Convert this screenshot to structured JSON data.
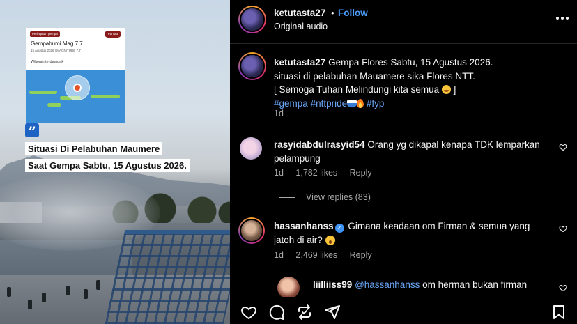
{
  "media": {
    "news_card": {
      "badge": "Peringatan gempa",
      "pill": "Pantau",
      "title": "Gempabumi Mag 7.7",
      "subtitle": "15 Agustus 2026 | MAGNITUDE 7.7",
      "area_label": "Wilayah terdampak"
    },
    "quote_icon": "quote-icon",
    "caption_line1": "Situasi Di Pelabuhan Maumere",
    "caption_line2": "Saat Gempa Sabtu, 15 Agustus 2026."
  },
  "post": {
    "username": "ketutasta27",
    "dot": "•",
    "follow_label": "Follow",
    "audio": "Original audio",
    "more_icon": "more-options-icon",
    "caption": {
      "username": "ketutasta27",
      "line1": "Gempa Flores Sabtu, 15 Agustus 2026.",
      "line2": "situasi di pelabuhan Mauamere sika Flores NTT.",
      "line3": "[ Semoga Tuhan Melindungi kita semua",
      "line3_end": "]",
      "hashtag1": "#gempa",
      "hashtag2": "#nttpride",
      "hashtag3": "#fyp",
      "time": "1d"
    }
  },
  "comments": [
    {
      "username": "rasyidabdulrasyid54",
      "text": "Orang yg dikapal kenapa TDK lemparkan pelampung",
      "time": "1d",
      "likes": "1,782 likes",
      "reply": "Reply",
      "view_replies": "View replies (83)"
    },
    {
      "username": "hassanhanss",
      "text": "Gimana keadaan om Firman & semua yang jatoh di air?",
      "time": "1d",
      "likes": "2,469 likes",
      "reply": "Reply"
    },
    {
      "username": "liilliiss99",
      "mention": "@hassanhanss",
      "text": "om herman bukan firman"
    }
  ],
  "actions": {
    "like": "heart-icon",
    "comment": "comment-icon",
    "share": "repost-icon",
    "send": "send-icon",
    "save": "bookmark-icon"
  },
  "colors": {
    "accent": "#4a9bf8",
    "hashtag": "#6aa6f8",
    "muted": "#a8a8a8",
    "background": "#000000"
  }
}
